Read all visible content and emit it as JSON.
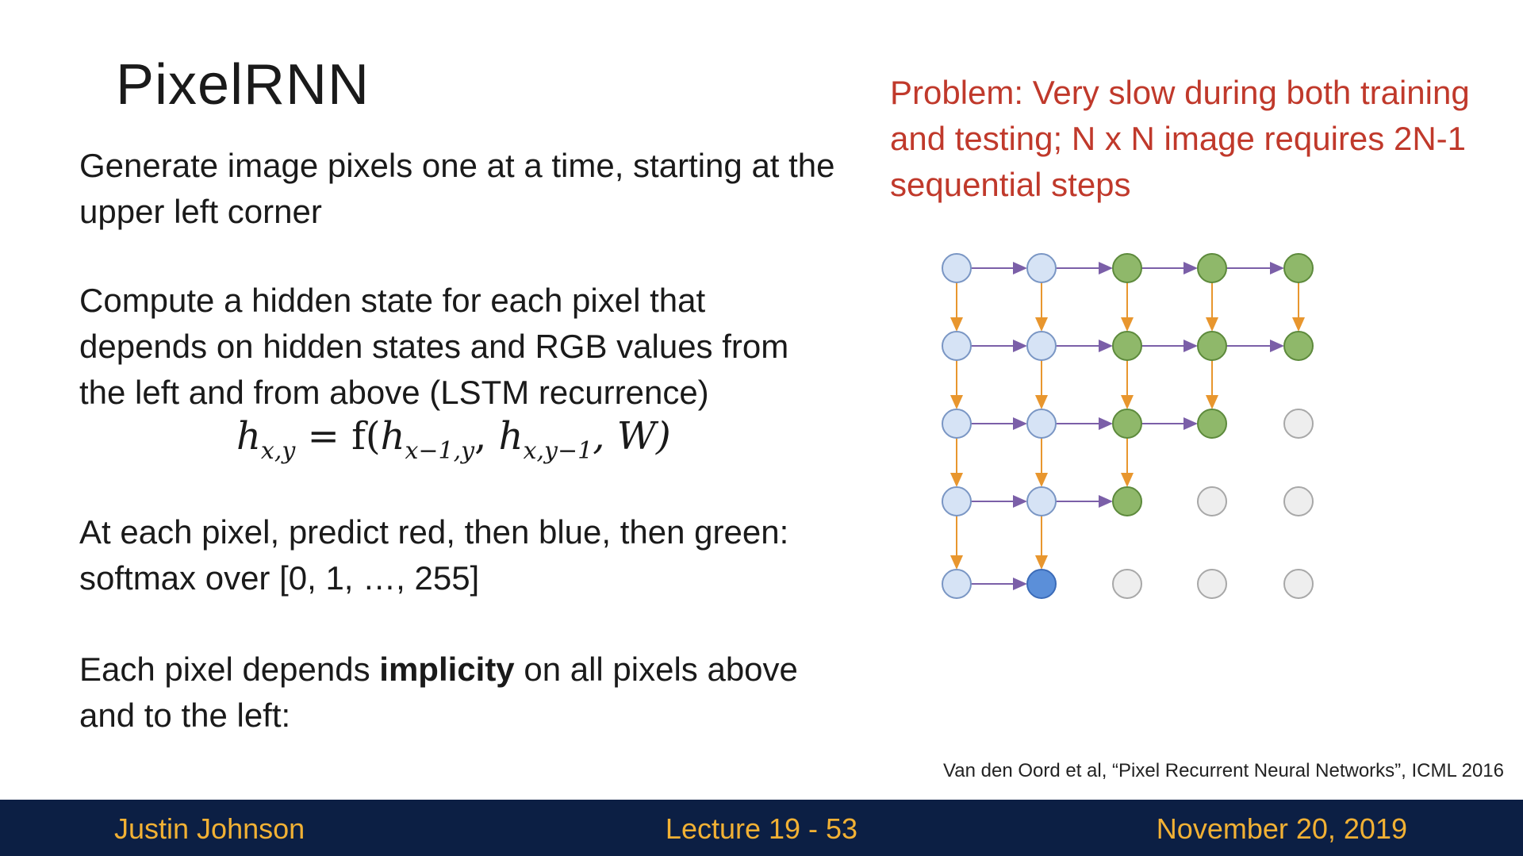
{
  "slide": {
    "title": "PixelRNN",
    "paragraph1": "Generate image pixels one at a time, starting at the upper left corner",
    "paragraph2": "Compute a hidden state for each pixel that depends on hidden states and RGB values from the left and from above (LSTM recurrence)",
    "formula": {
      "lhs": "h",
      "lhs_sub": "x,y",
      "eq": " = f(",
      "arg1": "h",
      "arg1_sub": "x−1,y",
      "arg2": "h",
      "arg2_sub": "x,y−1",
      "tail": ", W)"
    },
    "paragraph3": "At each pixel, predict red, then blue, then green: softmax over [0, 1, …, 255]",
    "paragraph4_pre": "Each pixel depends ",
    "paragraph4_bold": "implicity",
    "paragraph4_post": " on all pixels above and to the left:",
    "problem": "Problem: Very slow during both training and testing; N x N image requires 2N-1 sequential steps",
    "citation": "Van den Oord et al, “Pixel Recurrent Neural Networks”, ICML 2016"
  },
  "diagram": {
    "colors": {
      "light_blue": "#d6e3f5",
      "current_blue": "#5b8fd9",
      "green": "#8fb86a",
      "gray": "#eeeeee",
      "arrow_right": "#7b5fa8",
      "arrow_down": "#e8962e"
    },
    "cells": [
      [
        "light_blue",
        "light_blue",
        "green",
        "green",
        "green"
      ],
      [
        "light_blue",
        "light_blue",
        "green",
        "green",
        "green"
      ],
      [
        "light_blue",
        "light_blue",
        "green",
        "green",
        "gray"
      ],
      [
        "light_blue",
        "light_blue",
        "green",
        "gray",
        "gray"
      ],
      [
        "light_blue",
        "current_blue",
        "gray",
        "gray",
        "gray"
      ]
    ]
  },
  "footer": {
    "left": "Justin Johnson",
    "center": "Lecture 19 - 53",
    "right": "November 20, 2019"
  }
}
